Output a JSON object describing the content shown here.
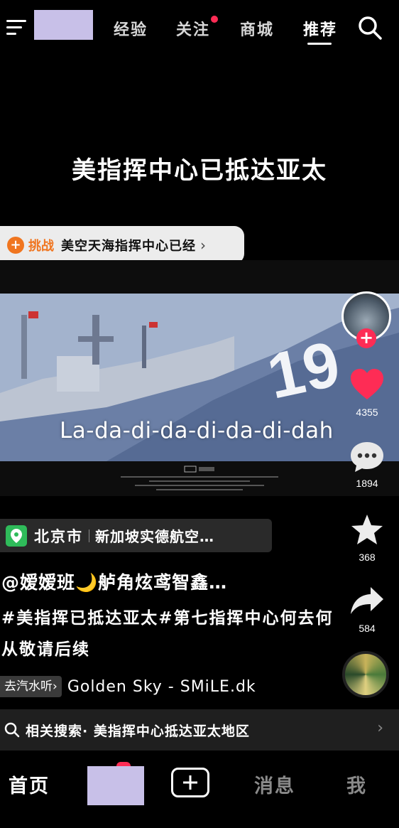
{
  "topnav": {
    "tabs": [
      {
        "label": "经验"
      },
      {
        "label": "关注"
      },
      {
        "label": "商城"
      },
      {
        "label": "推荐"
      }
    ],
    "active_tab": "推荐"
  },
  "video": {
    "headline": "美指挥中心已抵达亚太",
    "challenge": {
      "tag": "挑战",
      "text": "美空天海指挥中心已经"
    },
    "lyric": "La-da-di-da-di-da-di-dah"
  },
  "actions": {
    "likes": "4355",
    "comments": "1894",
    "favorites": "368",
    "shares": "584"
  },
  "info": {
    "location_city": "北京市",
    "location_place": "新加坡实德航空…",
    "author": "@嫒嫒班🌙舻角炫鸢智鑫…",
    "description": "#美指挥已抵达亚太#第七指挥中心何去何从敬请后续",
    "music_chip": "去汽水听",
    "music_name": "Golden Sky - SMiLE.dk",
    "related_search": "相关搜索· 美指挥中心抵达亚太地区"
  },
  "bottomnav": {
    "home": "首页",
    "messages": "消息",
    "me": "我"
  },
  "colors": {
    "accent_red": "#fe2c55",
    "challenge_orange": "#f0751f",
    "location_green": "#2fbb5a"
  },
  "icons": [
    "menu-icon",
    "search-icon",
    "heart-icon",
    "comment-icon",
    "star-icon",
    "share-icon",
    "location-pin-icon",
    "plus-icon",
    "chevron-right-icon"
  ]
}
